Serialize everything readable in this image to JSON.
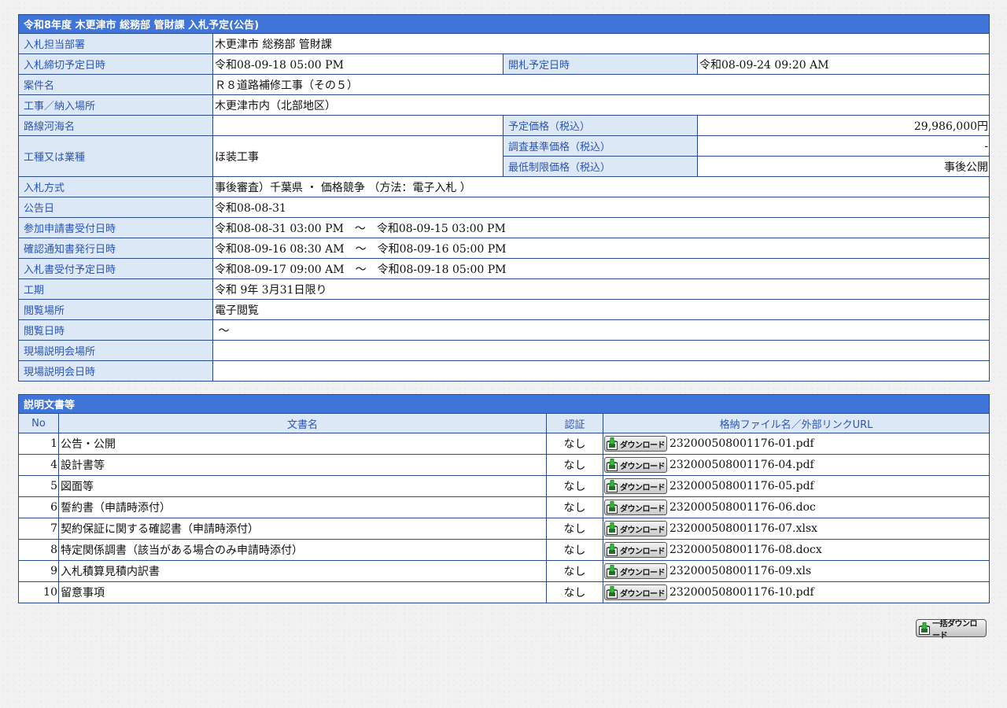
{
  "info": {
    "title": "令和8年度 木更津市 総務部 管財課 入札予定(公告)",
    "rows": {
      "dept": {
        "label": "入札担当部署",
        "value": "木更津市 総務部 管財課"
      },
      "deadline": {
        "label": "入札締切予定日時",
        "value": "令和08-09-18 05:00 PM"
      },
      "opening": {
        "label": "開札予定日時",
        "value": "令和08-09-24 09:20 AM"
      },
      "case_name": {
        "label": "案件名",
        "value": "Ｒ８道路補修工事（その５）"
      },
      "location": {
        "label": "工事／納入場所",
        "value": "木更津市内（北部地区）"
      },
      "route": {
        "label": "路線河海名",
        "value": ""
      },
      "planned_price": {
        "label": "予定価格（税込）",
        "value": "29,986,000円"
      },
      "work_type": {
        "label": "工種又は業種",
        "value": "ほ装工事"
      },
      "survey_price": {
        "label": "調査基準価格（税込）",
        "value": "-"
      },
      "min_price": {
        "label": "最低制限価格（税込）",
        "value": "事後公開"
      },
      "method": {
        "label": "入札方式",
        "value": "事後審査）千葉県 ・ 価格競争 （方法：電子入札 ）"
      },
      "notice_date": {
        "label": "公告日",
        "value": "令和08-08-31"
      },
      "application": {
        "label": "参加申請書受付日時",
        "value": "令和08-08-31 03:00 PM　～　令和08-09-15 03:00 PM"
      },
      "confirmation": {
        "label": "確認通知書発行日時",
        "value": "令和08-09-16 08:30 AM　～　令和08-09-16 05:00 PM"
      },
      "bid_receipt": {
        "label": "入札書受付予定日時",
        "value": "令和08-09-17 09:00 AM　～　令和08-09-18 05:00 PM"
      },
      "period": {
        "label": "工期",
        "value": "令和 9年 3月31日限り"
      },
      "viewing_place": {
        "label": "閲覧場所",
        "value": "電子閲覧"
      },
      "viewing_time": {
        "label": "閲覧日時",
        "value": " ～"
      },
      "site_place": {
        "label": "現場説明会場所",
        "value": ""
      },
      "site_time": {
        "label": "現場説明会日時",
        "value": ""
      }
    }
  },
  "docs": {
    "title": "説明文書等",
    "headers": {
      "no": "No",
      "name": "文書名",
      "cert": "認証",
      "file": "格納ファイル名／外部リンクURL"
    },
    "download_label": "ダウンロード",
    "rows": [
      {
        "no": "1",
        "name": "公告・公開",
        "cert": "なし",
        "file": "232000508001176-01.pdf"
      },
      {
        "no": "4",
        "name": "設計書等",
        "cert": "なし",
        "file": "232000508001176-04.pdf"
      },
      {
        "no": "5",
        "name": "図面等",
        "cert": "なし",
        "file": "232000508001176-05.pdf"
      },
      {
        "no": "6",
        "name": "誓約書（申請時添付）",
        "cert": "なし",
        "file": "232000508001176-06.doc"
      },
      {
        "no": "7",
        "name": "契約保証に関する確認書（申請時添付）",
        "cert": "なし",
        "file": "232000508001176-07.xlsx"
      },
      {
        "no": "8",
        "name": "特定関係調書（該当がある場合のみ申請時添付）",
        "cert": "なし",
        "file": "232000508001176-08.docx"
      },
      {
        "no": "9",
        "name": "入札積算見積内訳書",
        "cert": "なし",
        "file": "232000508001176-09.xls"
      },
      {
        "no": "10",
        "name": "留意事項",
        "cert": "なし",
        "file": "232000508001176-10.pdf"
      }
    ]
  },
  "bulk_download_label": "一括ダウンロード",
  "icons": {
    "download": "download-icon"
  }
}
